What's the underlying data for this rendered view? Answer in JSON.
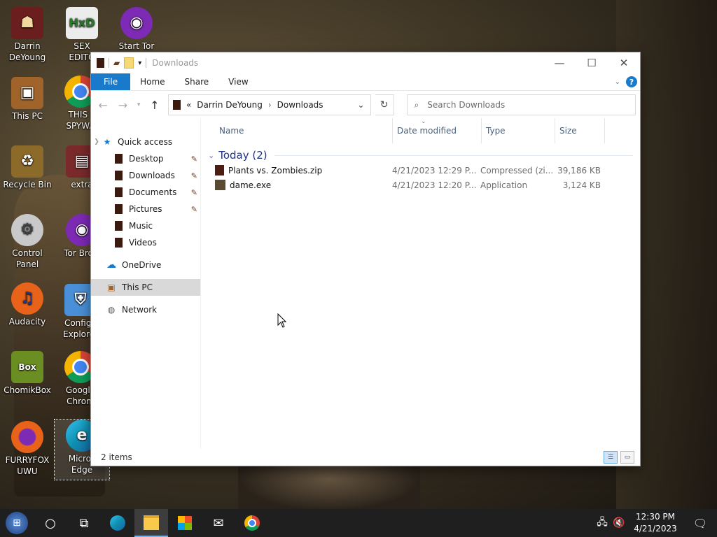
{
  "desktop": {
    "icons": [
      {
        "label": "Darrin\nDeYoung",
        "icon": "user-folder-icon",
        "color": "#6b1e1e"
      },
      {
        "label": "SEX\nEDITO",
        "icon": "hex-editor-icon",
        "color": "#e6e6e6"
      },
      {
        "label": "Start Tor",
        "icon": "tor-icon",
        "color": "#7d2ab5"
      },
      {
        "label": "This PC",
        "icon": "computer-icon",
        "color": "#a0642a"
      },
      {
        "label": "THIS I\nSPYWA",
        "icon": "chrome-icon",
        "color": "#2e7d32"
      },
      {
        "label": "Recycle Bin",
        "icon": "recycle-bin-icon",
        "color": "#8b6a2a"
      },
      {
        "label": "extra",
        "icon": "folder-icon",
        "color": "#7a2a2a"
      },
      {
        "label": "Control Panel",
        "icon": "control-panel-icon",
        "color": "#c9c9c9"
      },
      {
        "label": "Tor Brow",
        "icon": "tor-icon",
        "color": "#7d2ab5"
      },
      {
        "label": "Audacity",
        "icon": "audacity-icon",
        "color": "#e8621a"
      },
      {
        "label": "Configu\nExplorer",
        "icon": "shield-icon",
        "color": "#4a90d9"
      },
      {
        "label": "ChomikBox",
        "icon": "chomikbox-icon",
        "color": "#6b8e23"
      },
      {
        "label": "Google\nChrom",
        "icon": "chrome-icon",
        "color": "#2e7d32"
      },
      {
        "label": "FURRYFOX\nUWU",
        "icon": "firefox-icon",
        "color": "#e8621a"
      },
      {
        "label": "Micros\nEdge",
        "icon": "edge-icon",
        "color": "#0f8fb0"
      }
    ]
  },
  "window": {
    "title": "Downloads",
    "ribbon": {
      "file": "File",
      "home": "Home",
      "share": "Share",
      "view": "View",
      "help": "?"
    },
    "address": {
      "root": "«",
      "crumb1": "Darrin DeYoung",
      "sep": "›",
      "crumb2": "Downloads"
    },
    "search": {
      "placeholder": "Search Downloads"
    },
    "nav": {
      "quick_access": "Quick access",
      "items": [
        "Desktop",
        "Downloads",
        "Documents",
        "Pictures",
        "Music",
        "Videos"
      ],
      "onedrive": "OneDrive",
      "this_pc": "This PC",
      "network": "Network"
    },
    "columns": {
      "name": "Name",
      "date": "Date modified",
      "type": "Type",
      "size": "Size"
    },
    "group": "Today (2)",
    "files": [
      {
        "name": "Plants vs. Zombies.zip",
        "date": "4/21/2023 12:29 P...",
        "type": "Compressed (zi...",
        "size": "39,186 KB"
      },
      {
        "name": "dame.exe",
        "date": "4/21/2023 12:20 P...",
        "type": "Application",
        "size": "3,124 KB"
      }
    ],
    "status": "2 items"
  },
  "taskbar": {
    "time": "12:30 PM",
    "date": "4/21/2023"
  },
  "colors": {
    "accent": "#1979ca",
    "group_header": "#1e3287",
    "taskbar": "#1f1f1f"
  }
}
